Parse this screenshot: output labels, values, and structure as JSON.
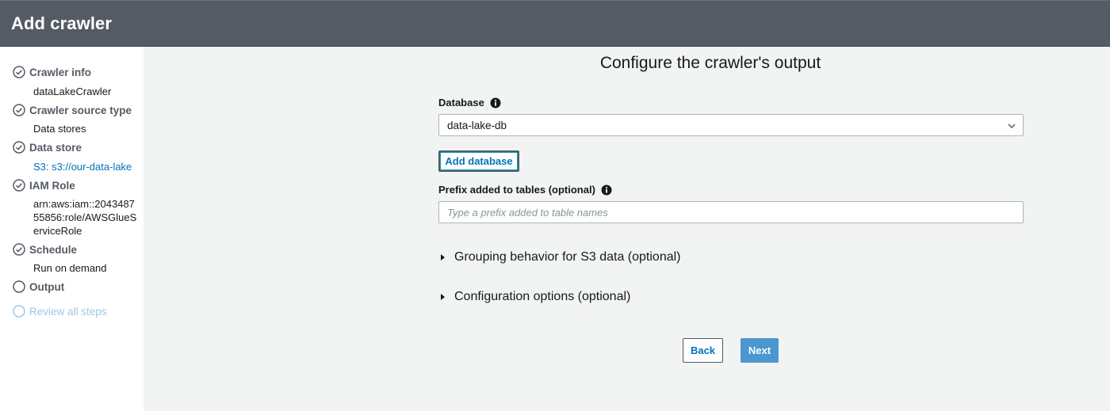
{
  "header": {
    "title": "Add crawler"
  },
  "sidebar": {
    "steps": [
      {
        "label": "Crawler info",
        "status": "complete",
        "value": "dataLakeCrawler"
      },
      {
        "label": "Crawler source type",
        "status": "complete",
        "value": "Data stores"
      },
      {
        "label": "Data store",
        "status": "complete",
        "value": "S3: s3://our-data-lake"
      },
      {
        "label": "IAM Role",
        "status": "complete",
        "value": "arn:aws:iam::204348755856:role/AWSGlueServiceRole"
      },
      {
        "label": "Schedule",
        "status": "complete",
        "value": "Run on demand"
      },
      {
        "label": "Output",
        "status": "current"
      },
      {
        "label": "Review all steps",
        "status": "disabled"
      }
    ]
  },
  "main": {
    "title": "Configure the crawler's output",
    "database": {
      "label": "Database",
      "selected": "data-lake-db",
      "add_button": "Add database"
    },
    "prefix": {
      "label": "Prefix added to tables (optional)",
      "value": "",
      "placeholder": "Type a prefix added to table names"
    },
    "sections": [
      {
        "label": "Grouping behavior for S3 data (optional)"
      },
      {
        "label": "Configuration options (optional)"
      }
    ],
    "back_button": "Back",
    "next_button": "Next"
  },
  "colors": {
    "header_bg": "#545b64",
    "link": "#0073bb",
    "primary_button": "#4b97cf",
    "disabled": "#9ec9e3"
  }
}
